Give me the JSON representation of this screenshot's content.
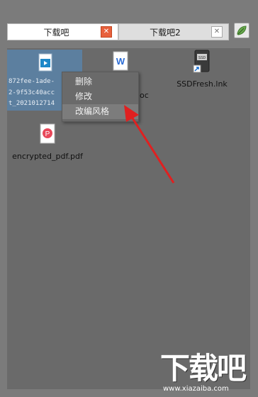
{
  "tabs": [
    {
      "label": "下载吧",
      "active": true,
      "close_icon": "close-icon"
    },
    {
      "label": "下载吧2",
      "active": false,
      "close_icon": "close-icon"
    }
  ],
  "toolbar": {
    "icon": "leaf-icon"
  },
  "files": [
    {
      "name_lines": [
        "872fee-1ade-",
        "2-9f53c40acc",
        "t_2021012714"
      ],
      "icon": "video-file-icon",
      "selected": true
    },
    {
      "name": "doc",
      "icon": "word-doc-icon"
    },
    {
      "name": "SSDFresh.lnk",
      "icon": "ssd-shortcut-icon"
    },
    {
      "name": "encrypted_pdf.pdf",
      "icon": "pdf-file-icon"
    }
  ],
  "context_menu": {
    "items": [
      {
        "label": "删除"
      },
      {
        "label": "修改"
      },
      {
        "label": "改编风格",
        "hover": true
      }
    ]
  },
  "watermark": {
    "brand": "下载吧",
    "url": "www.xiazaiba.com"
  },
  "colors": {
    "arrow": "#e02020",
    "active_close": "#e8603c",
    "selection": "#5c7f9f"
  }
}
